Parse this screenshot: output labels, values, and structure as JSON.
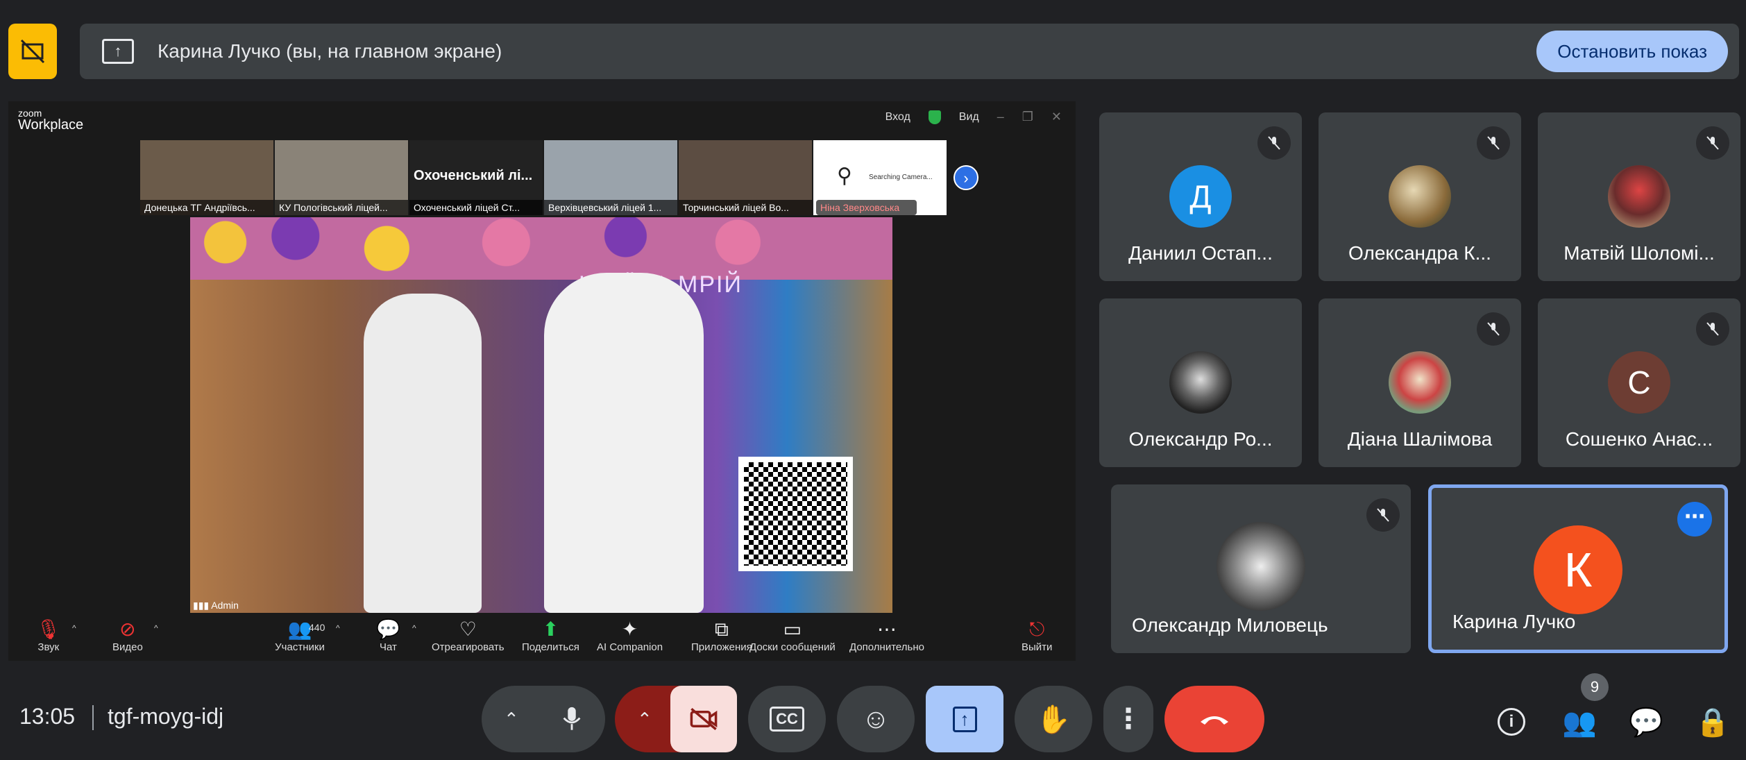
{
  "banner": {
    "title": "Карина Лучко (вы, на главном экране)",
    "stop_label": "Остановить показ"
  },
  "zoom": {
    "logo_small": "zoom",
    "logo_big": "Workplace",
    "top_login": "Вход",
    "top_view": "Вид",
    "strip": [
      {
        "label": "Донецька ТГ Андріївсь..."
      },
      {
        "label": "КУ Пологівський ліцей..."
      },
      {
        "label": "Охоченський ліцей Ст...",
        "big": "Охоченський лі..."
      },
      {
        "label": "Верхівцевський ліцей 1..."
      },
      {
        "label": "Торчинський ліцей Во..."
      },
      {
        "label": "Ніна Зверховська",
        "searching": "Searching Camera..."
      }
    ],
    "video_caption": "КРАЇНА МРІЙ",
    "video_user": "Admin",
    "toolbar": {
      "sound": "Звук",
      "video": "Видео",
      "participants": "Участники",
      "participants_count": "440",
      "chat": "Чат",
      "react": "Отреагировать",
      "share": "Поделиться",
      "ai": "AI Companion",
      "apps": "Приложения",
      "boards": "Доски сообщений",
      "more": "Дополнительно",
      "leave": "Выйти"
    }
  },
  "participants": [
    {
      "name": "Даниил Остап...",
      "initial": "Д",
      "color": "#1a8fe3"
    },
    {
      "name": "Олександра К..."
    },
    {
      "name": "Матвій Шоломі..."
    },
    {
      "name": "Олександр Ро..."
    },
    {
      "name": "Діана Шалімова"
    },
    {
      "name": "Сошенко Анас...",
      "initial": "С",
      "color": "#6d3d33"
    },
    {
      "name": "Олександр Миловець"
    },
    {
      "name": "Карина Лучко",
      "initial": "К",
      "color": "#f4511e"
    }
  ],
  "meeting": {
    "time": "13:05",
    "code": "tgf-moyg-idj",
    "participants_badge": "9"
  },
  "colors": {
    "accent": "#a8c7fa",
    "end_call": "#ea4335",
    "present": "#a8c7fa"
  }
}
